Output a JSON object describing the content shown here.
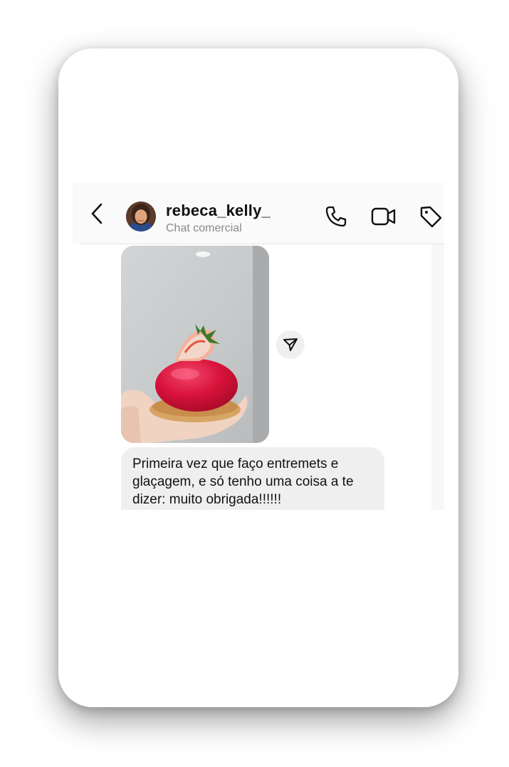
{
  "header": {
    "username": "rebeca_kelly_",
    "subtitle": "Chat comercial",
    "back_icon": "chevron-left-icon",
    "call_icon": "phone-icon",
    "video_icon": "video-camera-icon",
    "tag_icon": "tag-icon"
  },
  "messages": [
    {
      "type": "photo",
      "description_icon": "image-dessert-photo"
    },
    {
      "type": "text",
      "text": "Primeira vez que faço entremets e glaçagem, e só tenho uma coisa a te dizer: muito obrigada!!!!!!"
    }
  ],
  "share_icon": "send-icon",
  "colors": {
    "bubble": "#efefef",
    "text": "#111111",
    "subtitle": "#8a8a8a",
    "dessert": "#d8123a"
  }
}
